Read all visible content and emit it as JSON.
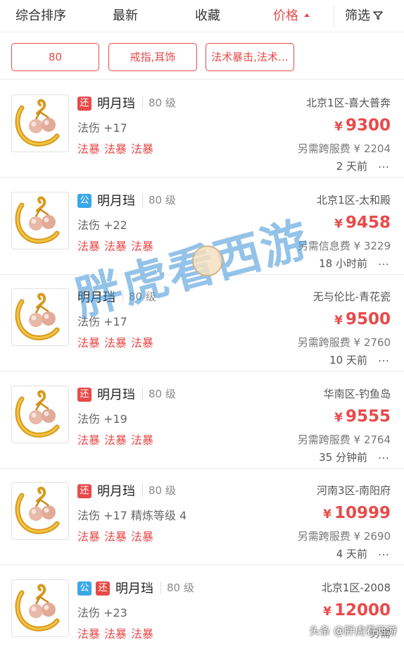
{
  "sort_bar": {
    "items": [
      "综合排序",
      "最新",
      "收藏",
      "价格"
    ],
    "active": "价格",
    "filter_label": "筛选"
  },
  "filters": [
    "80",
    "戒指,耳饰",
    "法术暴击,法术…"
  ],
  "listings": [
    {
      "badges": [
        {
          "text": "还",
          "color": "#e84a4a"
        }
      ],
      "name": "明月珰",
      "level": "80 级",
      "attribute": "法伤 +17",
      "tags": [
        "法暴",
        "法暴",
        "法暴"
      ],
      "server": "北京1区-喜大普奔",
      "price": "9300",
      "fee": "另需跨服费 ¥ 2204",
      "time": "2 天前"
    },
    {
      "badges": [
        {
          "text": "公",
          "color": "#3aa8e8"
        }
      ],
      "name": "明月珰",
      "level": "80 级",
      "attribute": "法伤 +22",
      "tags": [
        "法暴",
        "法暴",
        "法暴"
      ],
      "server": "北京1区-太和殿",
      "price": "9458",
      "fee": "另需信息费 ¥ 3229",
      "time": "18 小时前"
    },
    {
      "badges": [],
      "name": "明月珰",
      "level": "80 级",
      "attribute": "法伤 +17",
      "tags": [
        "法暴",
        "法暴",
        "法暴"
      ],
      "server": "无与伦比-青花瓷",
      "price": "9500",
      "fee": "另需跨服费 ¥ 2760",
      "time": "10 天前"
    },
    {
      "badges": [
        {
          "text": "还",
          "color": "#e84a4a"
        }
      ],
      "name": "明月珰",
      "level": "80 级",
      "attribute": "法伤 +19",
      "tags": [
        "法暴",
        "法暴",
        "法暴"
      ],
      "server": "华南区-钓鱼岛",
      "price": "9555",
      "fee": "另需跨服费 ¥ 2764",
      "time": "35 分钟前"
    },
    {
      "badges": [
        {
          "text": "还",
          "color": "#e84a4a"
        }
      ],
      "name": "明月珰",
      "level": "80 级",
      "attribute": "法伤 +17 精炼等级 4",
      "tags": [
        "法暴",
        "法暴",
        "法暴"
      ],
      "server": "河南3区-南阳府",
      "price": "10999",
      "fee": "另需跨服费 ¥ 2690",
      "time": "4 天前"
    },
    {
      "badges": [
        {
          "text": "公",
          "color": "#3aa8e8"
        },
        {
          "text": "还",
          "color": "#e84a4a"
        }
      ],
      "name": "明月珰",
      "level": "80 级",
      "attribute": "法伤 +23",
      "tags": [
        "法暴",
        "法暴",
        "法暴"
      ],
      "server": "北京1区-2008",
      "price": "12000",
      "fee": "另需",
      "time": ""
    }
  ],
  "currency_symbol": "¥",
  "more_label": "…",
  "watermark": "胖虎看西游",
  "corner_watermark": "头条 @胖虎看西游",
  "colors": {
    "accent": "#e84a4a",
    "official_badge": "#3aa8e8"
  },
  "icons": {
    "filter": "funnel-icon",
    "sort_direction": "caret-up-icon",
    "item": "pearl-earring-icon"
  }
}
